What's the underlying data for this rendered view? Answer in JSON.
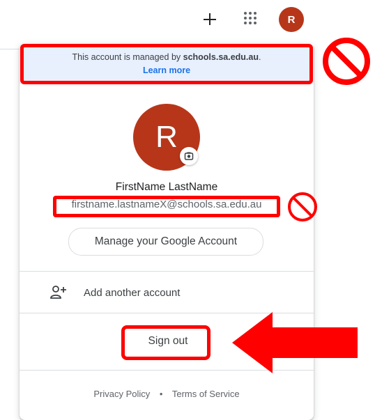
{
  "topbar": {
    "create_icon": "plus-icon",
    "apps_icon": "apps-grid-icon",
    "avatar_initial": "R"
  },
  "panel": {
    "managed_prefix": "This account is managed by ",
    "managed_domain": "schools.sa.edu.au",
    "managed_suffix": ".",
    "learn_more": "Learn more",
    "avatar_initial": "R",
    "camera_icon": "camera-icon",
    "name": "FirstName LastName",
    "email": "firstname.lastnameX@schools.sa.edu.au",
    "manage_account": "Manage your Google Account",
    "add_account_icon": "person-add-icon",
    "add_account": "Add another account",
    "sign_out": "Sign out",
    "privacy_policy": "Privacy Policy",
    "separator": "•",
    "terms_of_service": "Terms of Service"
  },
  "annotations": {
    "highlight_color": "#ff0000",
    "prohibited_icon": "prohibited-icon",
    "arrow_icon": "arrow-left-icon"
  },
  "colors": {
    "avatar_bg": "#b7361a",
    "link_blue": "#1a73e8",
    "managed_banner_bg": "#e8f0fe"
  }
}
